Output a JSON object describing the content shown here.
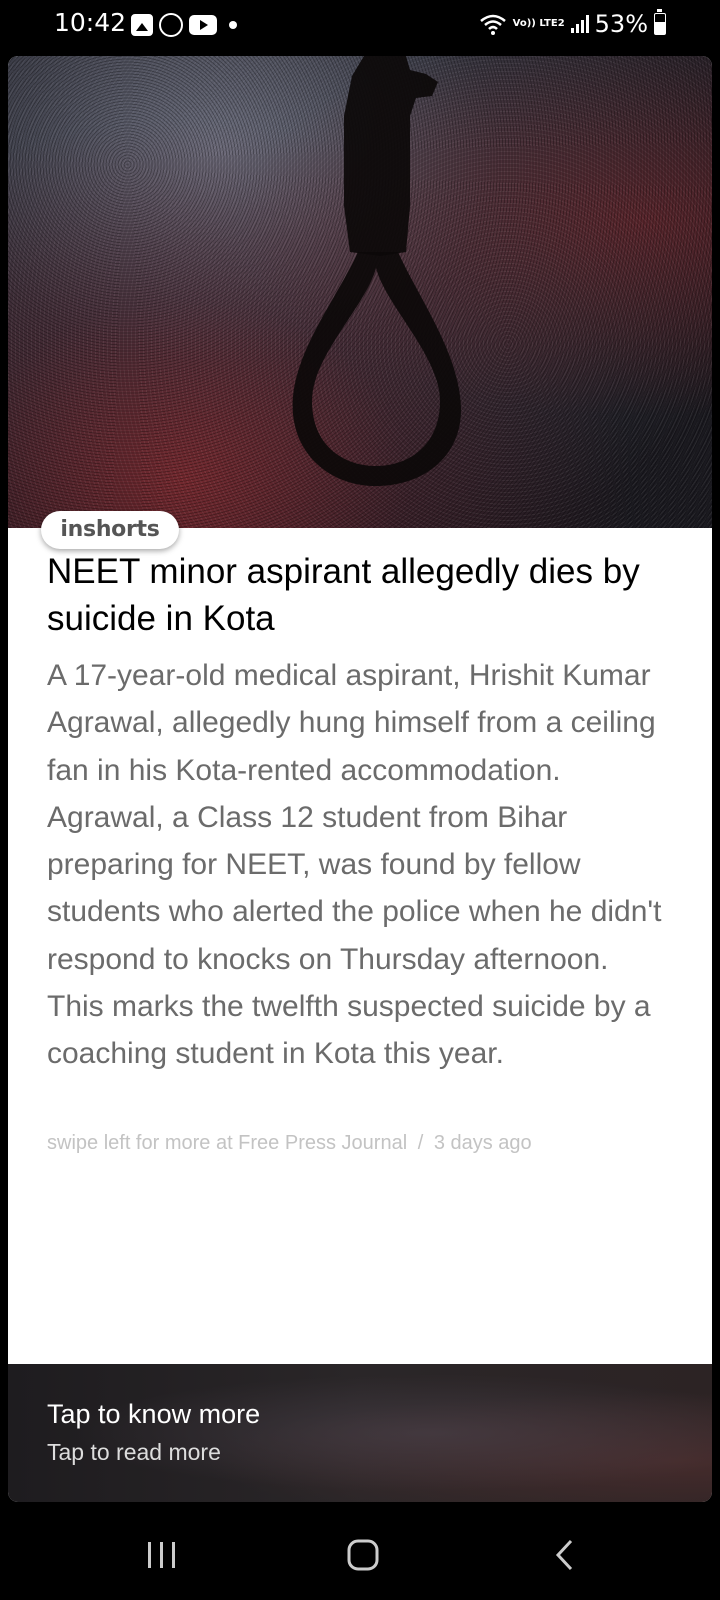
{
  "status_bar": {
    "time": "10:42",
    "network_label": "Vo)) LTE2",
    "battery": "53%"
  },
  "card": {
    "source": "inshorts",
    "headline": "NEET minor aspirant allegedly dies by suicide in Kota",
    "body": "A 17-year-old medical aspirant, Hrishit Kumar Agrawal, allegedly hung himself from a ceiling fan in his Kota-rented accommodation. Agrawal, a Class 12 student from Bihar preparing for NEET, was found by fellow students who alerted the police when he didn't respond to knocks on Thursday afternoon. This marks the twelfth suspected suicide by a coaching student in Kota this year.",
    "footer_prefix": "swipe left for more at Free Press Journal",
    "footer_separator": "/",
    "footer_time": "3 days ago"
  },
  "banner": {
    "title": "Tap to know more",
    "subtitle": "Tap to read more"
  },
  "nav": {
    "recents": "recents-icon",
    "home": "home-icon",
    "back": "back-icon"
  }
}
